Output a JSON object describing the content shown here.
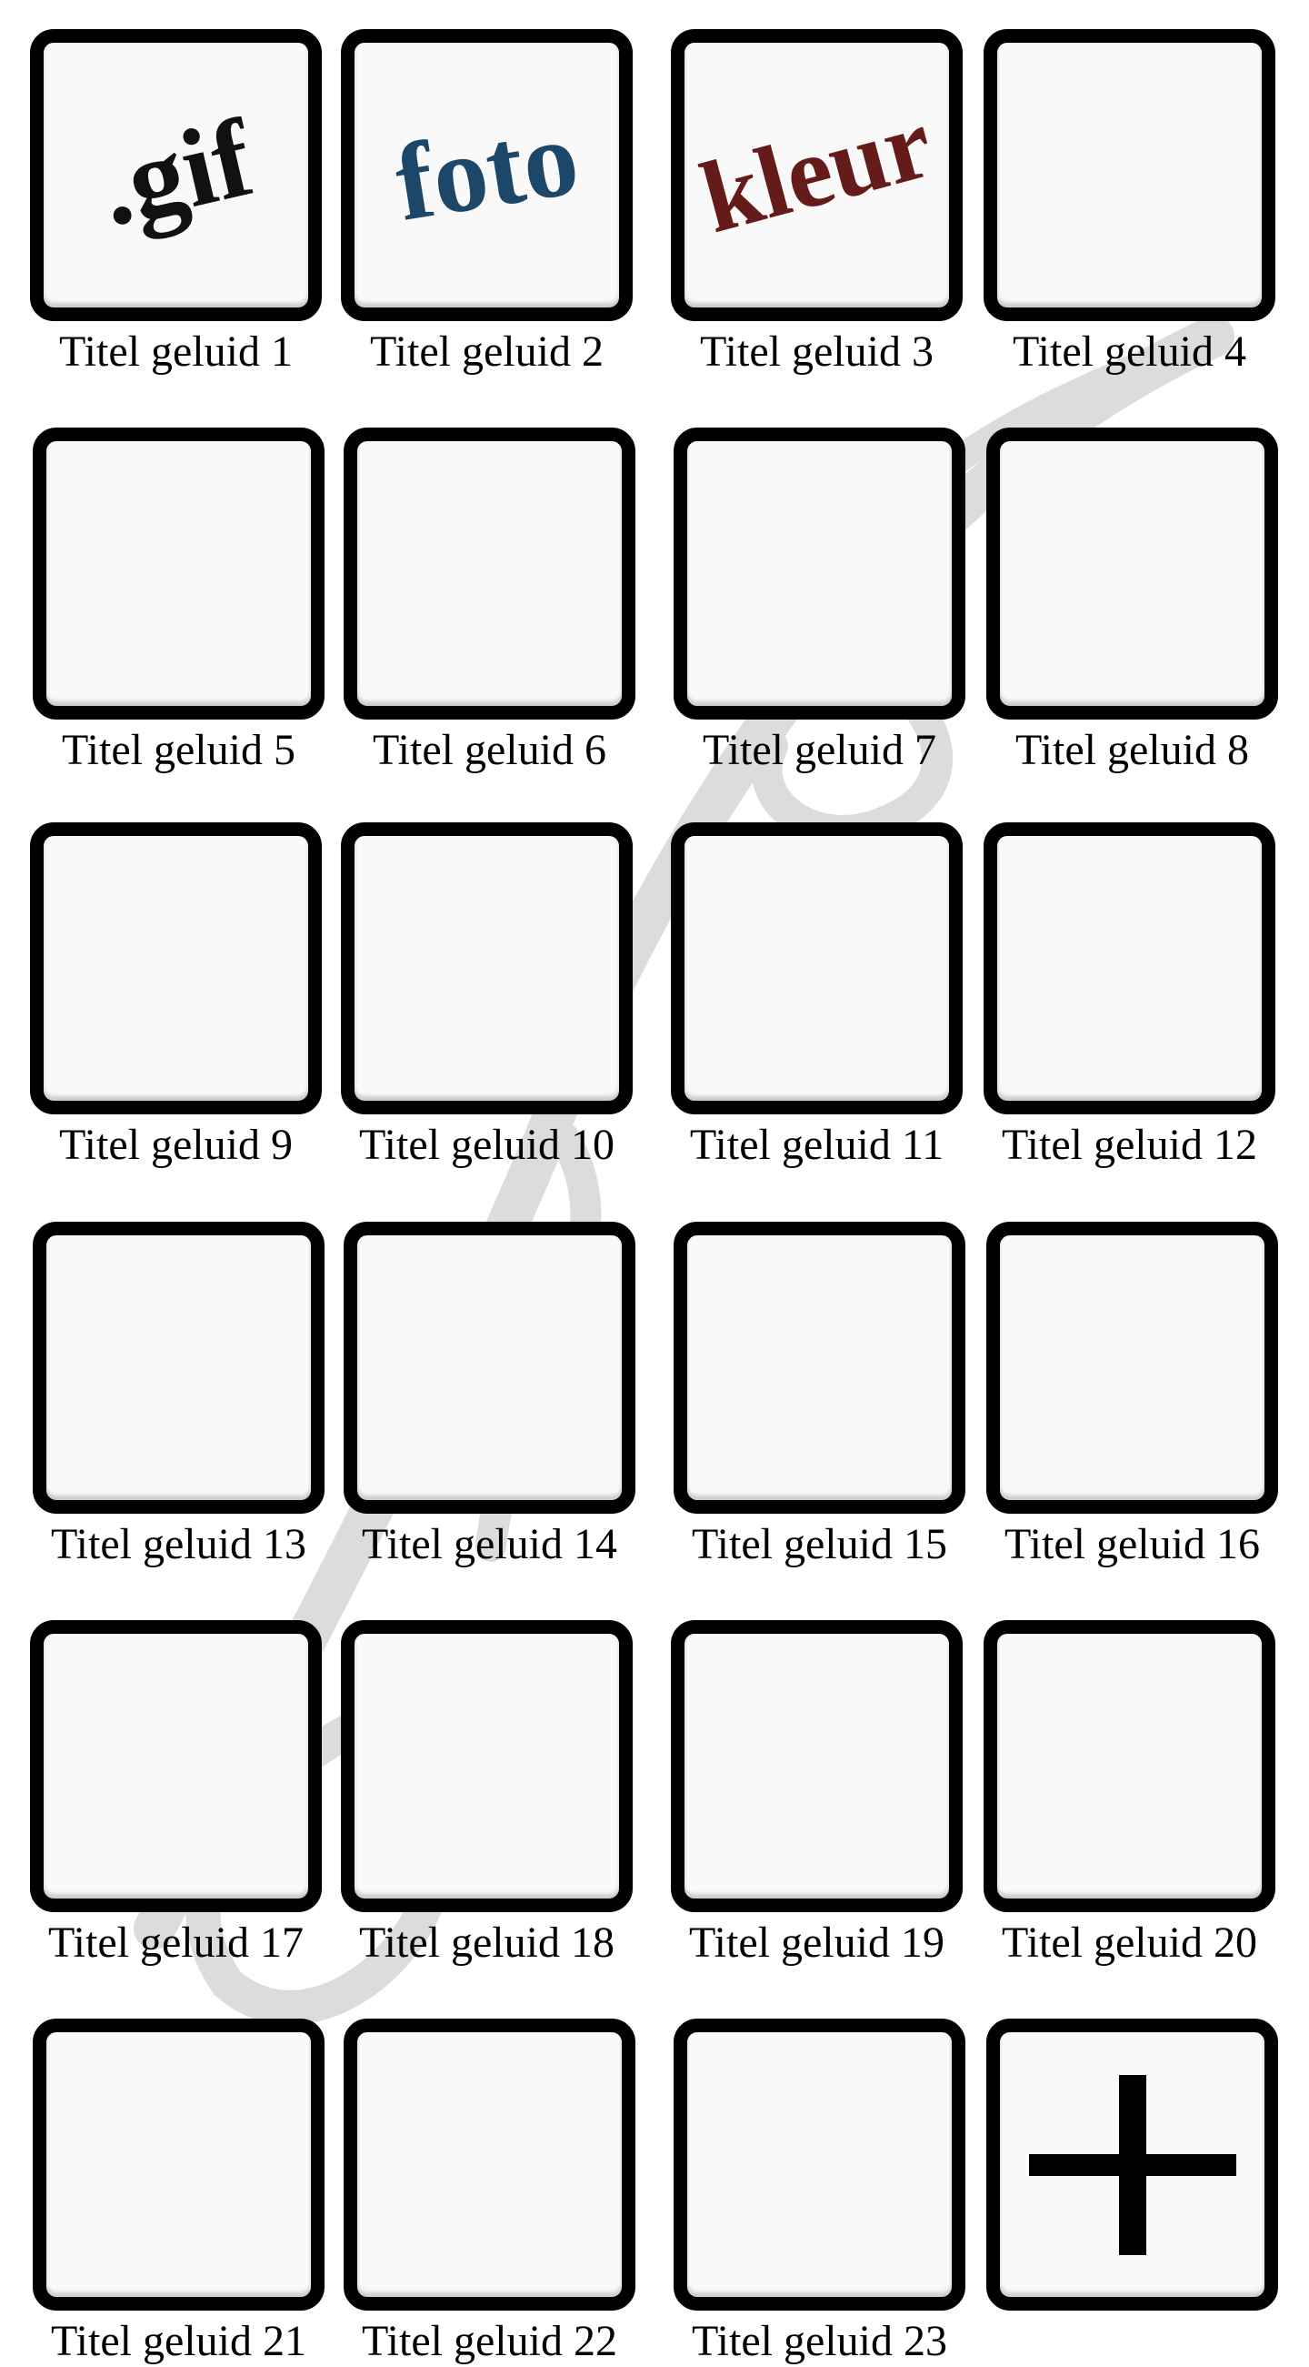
{
  "watermark_text": "Gurdal",
  "tiles": [
    {
      "title": "Titel geluid 1",
      "label": ".gif",
      "label_style": "gif"
    },
    {
      "title": "Titel geluid 2",
      "label": "foto",
      "label_style": "foto"
    },
    {
      "title": "Titel geluid 3",
      "label": "kleur",
      "label_style": "kleur"
    },
    {
      "title": "Titel geluid 4"
    },
    {
      "title": "Titel geluid 5"
    },
    {
      "title": "Titel geluid 6"
    },
    {
      "title": "Titel geluid 7"
    },
    {
      "title": "Titel geluid 8"
    },
    {
      "title": "Titel geluid 9"
    },
    {
      "title": "Titel geluid 10"
    },
    {
      "title": "Titel geluid 11"
    },
    {
      "title": "Titel geluid 12"
    },
    {
      "title": "Titel geluid 13"
    },
    {
      "title": "Titel geluid 14"
    },
    {
      "title": "Titel geluid 15"
    },
    {
      "title": "Titel geluid 16"
    },
    {
      "title": "Titel geluid 17"
    },
    {
      "title": "Titel geluid 18"
    },
    {
      "title": "Titel geluid 19"
    },
    {
      "title": "Titel geluid 20"
    },
    {
      "title": "Titel geluid 21"
    },
    {
      "title": "Titel geluid 22"
    },
    {
      "title": "Titel geluid 23"
    }
  ],
  "add_button": {
    "icon": "plus-icon"
  },
  "colors": {
    "border": "#000000",
    "tile_fill": "#f9f9f9",
    "gif": "#111111",
    "foto": "#1c4769",
    "kleur": "#661b1b",
    "watermark": "#dcdcdc"
  }
}
